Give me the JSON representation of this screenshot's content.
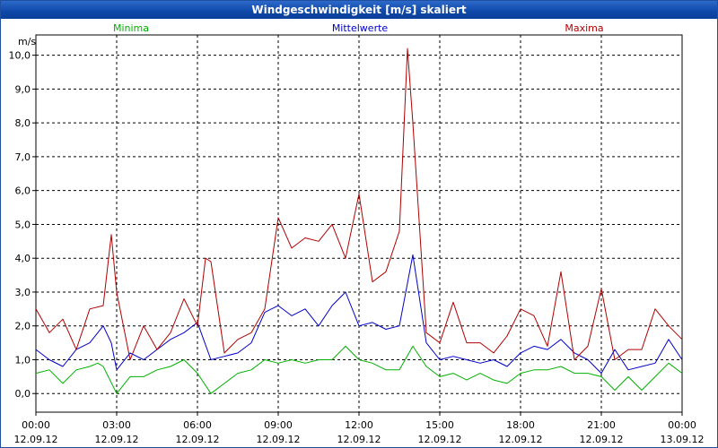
{
  "window": {
    "title": "Windgeschwindigkeit [m/s] skaliert"
  },
  "chart_data": {
    "type": "line",
    "title": "Windgeschwindigkeit [m/s] skaliert",
    "ylabel": "m/s",
    "xlabel": "",
    "ylim": [
      -0.55,
      10.6
    ],
    "yticks": [
      0,
      1,
      2,
      3,
      4,
      5,
      6,
      7,
      8,
      9,
      10
    ],
    "ytick_labels": [
      "0,0",
      "1,0",
      "2,0",
      "3,0",
      "4,0",
      "5,0",
      "6,0",
      "7,0",
      "8,0",
      "9,0",
      "10,0"
    ],
    "xlim_hours": [
      0,
      24
    ],
    "xticks": [
      {
        "time": "00:00",
        "date": "12.09.12"
      },
      {
        "time": "03:00",
        "date": "12.09.12"
      },
      {
        "time": "06:00",
        "date": "12.09.12"
      },
      {
        "time": "09:00",
        "date": "12.09.12"
      },
      {
        "time": "12:00",
        "date": "12.09.12"
      },
      {
        "time": "15:00",
        "date": "12.09.12"
      },
      {
        "time": "18:00",
        "date": "12.09.12"
      },
      {
        "time": "21:00",
        "date": "12.09.12"
      },
      {
        "time": "00:00",
        "date": "13.09.12"
      }
    ],
    "grid": true,
    "legend_placement": "top",
    "series": [
      {
        "name": "Minima",
        "color": "#00b000",
        "x": [
          0,
          0.5,
          1,
          1.5,
          2,
          2.3,
          2.5,
          3,
          3.5,
          4,
          4.5,
          5,
          5.5,
          6,
          6.5,
          7,
          7.5,
          8,
          8.5,
          9,
          9.5,
          10,
          10.5,
          11,
          11.5,
          12,
          12.5,
          13,
          13.5,
          14,
          14.5,
          15,
          15.5,
          16,
          16.5,
          17,
          17.5,
          18,
          18.5,
          19,
          19.5,
          20,
          20.5,
          21,
          21.5,
          22,
          22.5,
          23,
          23.5,
          24
        ],
        "y": [
          0.6,
          0.7,
          0.3,
          0.7,
          0.8,
          0.9,
          0.8,
          0.0,
          0.5,
          0.5,
          0.7,
          0.8,
          1.0,
          0.6,
          0.0,
          0.3,
          0.6,
          0.7,
          1.0,
          0.9,
          1.0,
          0.9,
          1.0,
          1.0,
          1.4,
          1.0,
          0.9,
          0.7,
          0.7,
          1.4,
          0.8,
          0.5,
          0.6,
          0.4,
          0.6,
          0.4,
          0.3,
          0.6,
          0.7,
          0.7,
          0.8,
          0.6,
          0.6,
          0.5,
          0.1,
          0.5,
          0.1,
          0.5,
          0.9,
          0.6
        ]
      },
      {
        "name": "Mittelwerte",
        "color": "#0000c8",
        "x": [
          0,
          0.5,
          1,
          1.5,
          2,
          2.5,
          2.8,
          3,
          3.5,
          4,
          4.5,
          5,
          5.5,
          6,
          6.5,
          7,
          7.5,
          8,
          8.5,
          9,
          9.5,
          10,
          10.5,
          11,
          11.5,
          12,
          12.5,
          13,
          13.5,
          14,
          14.5,
          15,
          15.5,
          16,
          16.5,
          17,
          17.5,
          18,
          18.5,
          19,
          19.5,
          20,
          20.5,
          21,
          21.5,
          22,
          22.5,
          23,
          23.5,
          24
        ],
        "y": [
          1.3,
          1.0,
          0.8,
          1.3,
          1.5,
          2.0,
          1.5,
          0.7,
          1.2,
          1.0,
          1.3,
          1.6,
          1.8,
          2.1,
          1.0,
          1.1,
          1.2,
          1.5,
          2.4,
          2.6,
          2.3,
          2.5,
          2.0,
          2.6,
          3.0,
          2.0,
          2.1,
          1.9,
          2.0,
          4.1,
          1.5,
          1.0,
          1.1,
          1.0,
          0.9,
          1.0,
          0.8,
          1.2,
          1.4,
          1.3,
          1.6,
          1.2,
          1.0,
          0.6,
          1.3,
          0.7,
          0.8,
          0.9,
          1.6,
          1.0
        ]
      },
      {
        "name": "Maxima",
        "color": "#b00000",
        "x": [
          0,
          0.5,
          1,
          1.5,
          2,
          2.5,
          2.8,
          3,
          3.5,
          4,
          4.5,
          5,
          5.5,
          6,
          6.3,
          6.5,
          7,
          7.5,
          8,
          8.5,
          9,
          9.5,
          10,
          10.5,
          11,
          11.5,
          12,
          12.5,
          13,
          13.5,
          13.8,
          14,
          14.5,
          15,
          15.5,
          16,
          16.5,
          17,
          17.5,
          18,
          18.5,
          19,
          19.5,
          20,
          20.5,
          21,
          21.5,
          22,
          22.5,
          23,
          23.5,
          24
        ],
        "y": [
          2.5,
          1.8,
          2.2,
          1.3,
          2.5,
          2.6,
          4.7,
          3.0,
          1.0,
          2.0,
          1.3,
          1.8,
          2.8,
          2.0,
          4.0,
          3.9,
          1.2,
          1.6,
          1.8,
          2.5,
          5.2,
          4.3,
          4.6,
          4.5,
          5.0,
          4.0,
          5.9,
          3.3,
          3.6,
          4.8,
          10.2,
          8.0,
          1.8,
          1.5,
          2.7,
          1.5,
          1.5,
          1.2,
          1.7,
          2.5,
          2.3,
          1.4,
          3.6,
          1.0,
          1.4,
          3.1,
          1.0,
          1.3,
          1.3,
          2.5,
          2.0,
          1.6
        ]
      }
    ]
  }
}
